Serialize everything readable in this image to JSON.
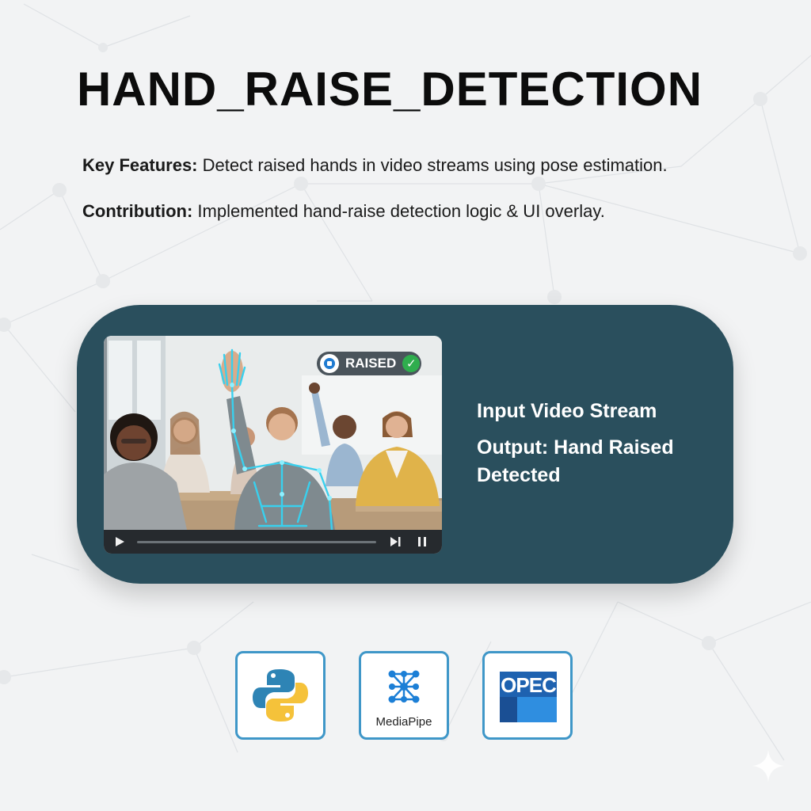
{
  "title": "HAND_RAISE_DETECTION",
  "features": {
    "key_label": "Key Features:",
    "key_text": " Detect raised hands in video streams using pose estimation.",
    "contribution_label": "Contribution:",
    "contribution_text": " Implemented hand-raise detection logic & UI overlay."
  },
  "video": {
    "badge_label": "RAISED",
    "progress": 0.0
  },
  "panel": {
    "input_label": "Input Video Stream",
    "output_line1": "Output: Hand Raised",
    "output_line2": "Detected"
  },
  "logos": {
    "python_icon": "python-logo",
    "mediapipe_label": "MediaPipe",
    "opencv_label": "OPEC"
  },
  "colors": {
    "background": "#f2f3f4",
    "panel": "#2a4f5d",
    "logo_border": "#3f97c8",
    "skeleton": "#39d0ee",
    "badge_check": "#2fae4e"
  }
}
